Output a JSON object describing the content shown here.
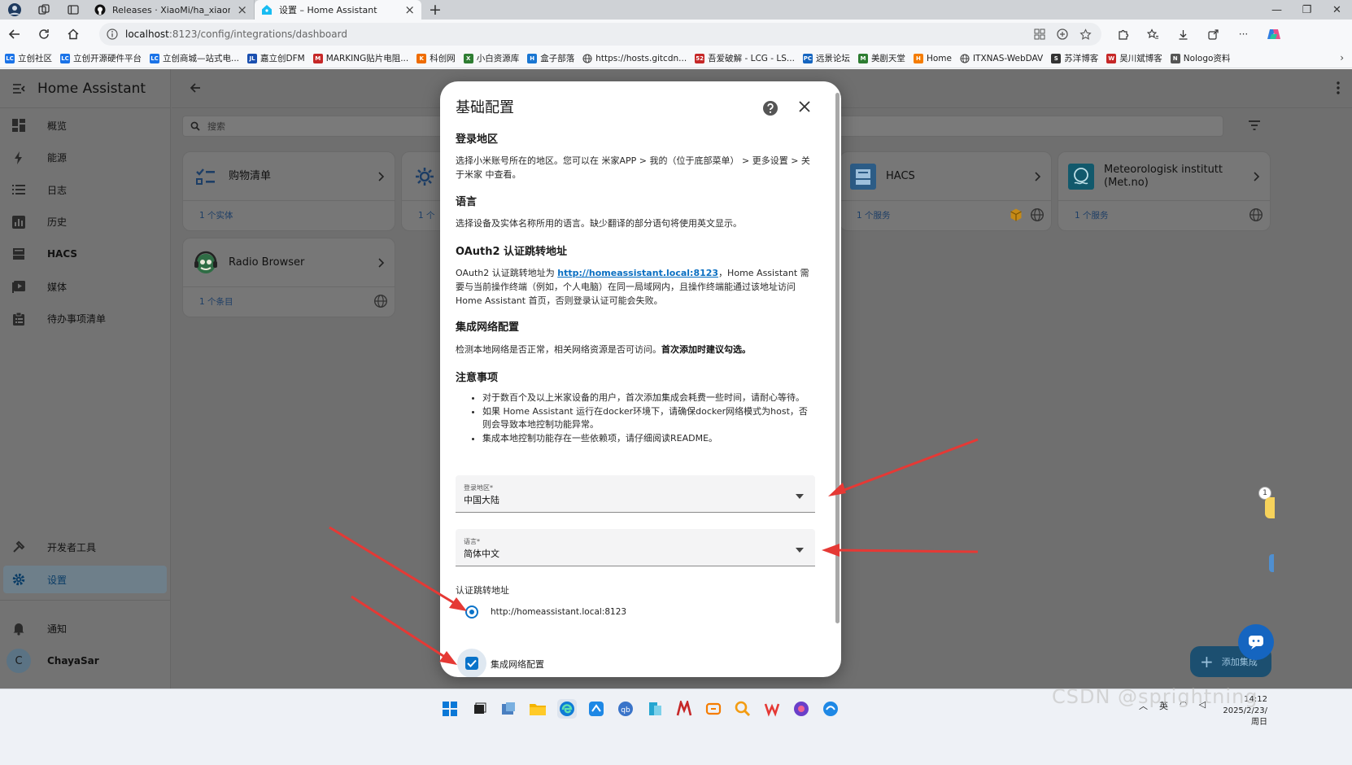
{
  "browser": {
    "tabs": [
      {
        "title": "Releases · XiaoMi/ha_xiaomi_hom",
        "active": false
      },
      {
        "title": "设置 – Home Assistant",
        "active": true
      }
    ],
    "url_host": "localhost",
    "url_rest": ":8123/config/integrations/dashboard",
    "bookmarks": [
      {
        "label": "立创社区",
        "color": "#1a73e8",
        "icon": "LC"
      },
      {
        "label": "立创开源硬件平台",
        "color": "#1a73e8",
        "icon": "LC"
      },
      {
        "label": "立创商城—站式电...",
        "color": "#1a73e8",
        "icon": "LC"
      },
      {
        "label": "嘉立创DFM",
        "color": "#1a4fb0",
        "icon": "JLC"
      },
      {
        "label": "MARKING贴片电阻...",
        "color": "#c62828",
        "icon": "M"
      },
      {
        "label": "科创网",
        "color": "#ef6c00",
        "icon": "K"
      },
      {
        "label": "小白资源库",
        "color": "#2e7d32",
        "icon": "X"
      },
      {
        "label": "盒子部落",
        "color": "#1976d2",
        "icon": "H"
      },
      {
        "label": "https://hosts.gitcdn...",
        "color": "#555555",
        "icon": "globe"
      },
      {
        "label": "吾爱破解 - LCG - LS...",
        "color": "#c62828",
        "icon": "52"
      },
      {
        "label": "远景论坛",
        "color": "#1565c0",
        "icon": "PC"
      },
      {
        "label": "美剧天堂",
        "color": "#2e7d32",
        "icon": "M"
      },
      {
        "label": "Home",
        "color": "#f57c00",
        "icon": "H"
      },
      {
        "label": "ITXNAS-WebDAV",
        "color": "#555555",
        "icon": "globe"
      },
      {
        "label": "苏洋博客",
        "color": "#333333",
        "icon": "S"
      },
      {
        "label": "吴川斌博客",
        "color": "#c62828",
        "icon": "W"
      },
      {
        "label": "Nologo资料",
        "color": "#555555",
        "icon": "N"
      }
    ]
  },
  "sidebar": {
    "title": "Home Assistant",
    "items": [
      {
        "label": "概览",
        "icon": "dashboard-icon"
      },
      {
        "label": "能源",
        "icon": "lightning-icon"
      },
      {
        "label": "日志",
        "icon": "list-icon"
      },
      {
        "label": "历史",
        "icon": "chart-icon"
      },
      {
        "label": "HACS",
        "icon": "hacs-icon"
      },
      {
        "label": "媒体",
        "icon": "play-icon"
      },
      {
        "label": "待办事项清单",
        "icon": "clipboard-icon"
      }
    ],
    "dev_tools": "开发者工具",
    "settings": "设置",
    "notifications": "通知",
    "user_initial": "C",
    "user_name": "ChayaSar"
  },
  "main": {
    "search_placeholder": "搜索",
    "cards": [
      {
        "title": "购物清单",
        "footer": "1 个实体"
      },
      {
        "title": "",
        "footer": "1 个"
      },
      {
        "title": "HACS",
        "footer": "1 个服务"
      },
      {
        "title": "Meteorologisk institutt (Met.no)",
        "footer": "1 个服务"
      },
      {
        "title": "Radio Browser",
        "footer": "1 个条目"
      }
    ],
    "fab_label": "添加集成",
    "notif_count": "1"
  },
  "dialog": {
    "title": "基础配置",
    "sections": {
      "region_title": "登录地区",
      "region_text": "选择小米账号所在的地区。您可以在 米家APP > 我的（位于底部菜单） > 更多设置 > 关于米家 中查看。",
      "lang_title": "语言",
      "lang_text": "选择设备及实体名称所用的语言。缺少翻译的部分语句将使用英文显示。",
      "oauth_title": "OAuth2 认证跳转地址",
      "oauth_text_pre": "OAuth2 认证跳转地址为 ",
      "oauth_link": "http://homeassistant.local:8123",
      "oauth_text_post": "，Home Assistant 需要与当前操作终端（例如，个人电脑）在同一局域网内，且操作终端能通过该地址访问 Home Assistant 首页，否则登录认证可能会失败。",
      "net_title": "集成网络配置",
      "net_text": "检测本地网络是否正常，相关网络资源是否可访问。",
      "net_text_bold": "首次添加时建议勾选。",
      "notes_title": "注意事项",
      "notes": [
        "对于数百个及以上米家设备的用户，首次添加集成会耗费一些时间，请耐心等待。",
        "如果 Home Assistant 运行在docker环境下，请确保docker网络模式为host，否则会导致本地控制功能异常。",
        "集成本地控制功能存在一些依赖项，请仔细阅读README。"
      ]
    },
    "region_field": {
      "label": "登录地区*",
      "value": "中国大陆"
    },
    "language_field": {
      "label": "语言*",
      "value": "简体中文"
    },
    "redirect_label": "认证跳转地址",
    "redirect_option": "http://homeassistant.local:8123",
    "network_checkbox": "集成网络配置"
  },
  "taskbar": {
    "tray_ime": "英",
    "clock_time": "14:12",
    "clock_date": "2025/2/23/周日"
  },
  "watermark": "CSDN @sprightning",
  "colors": {
    "accent": "#0a73c9",
    "annotation": "#e53935"
  }
}
